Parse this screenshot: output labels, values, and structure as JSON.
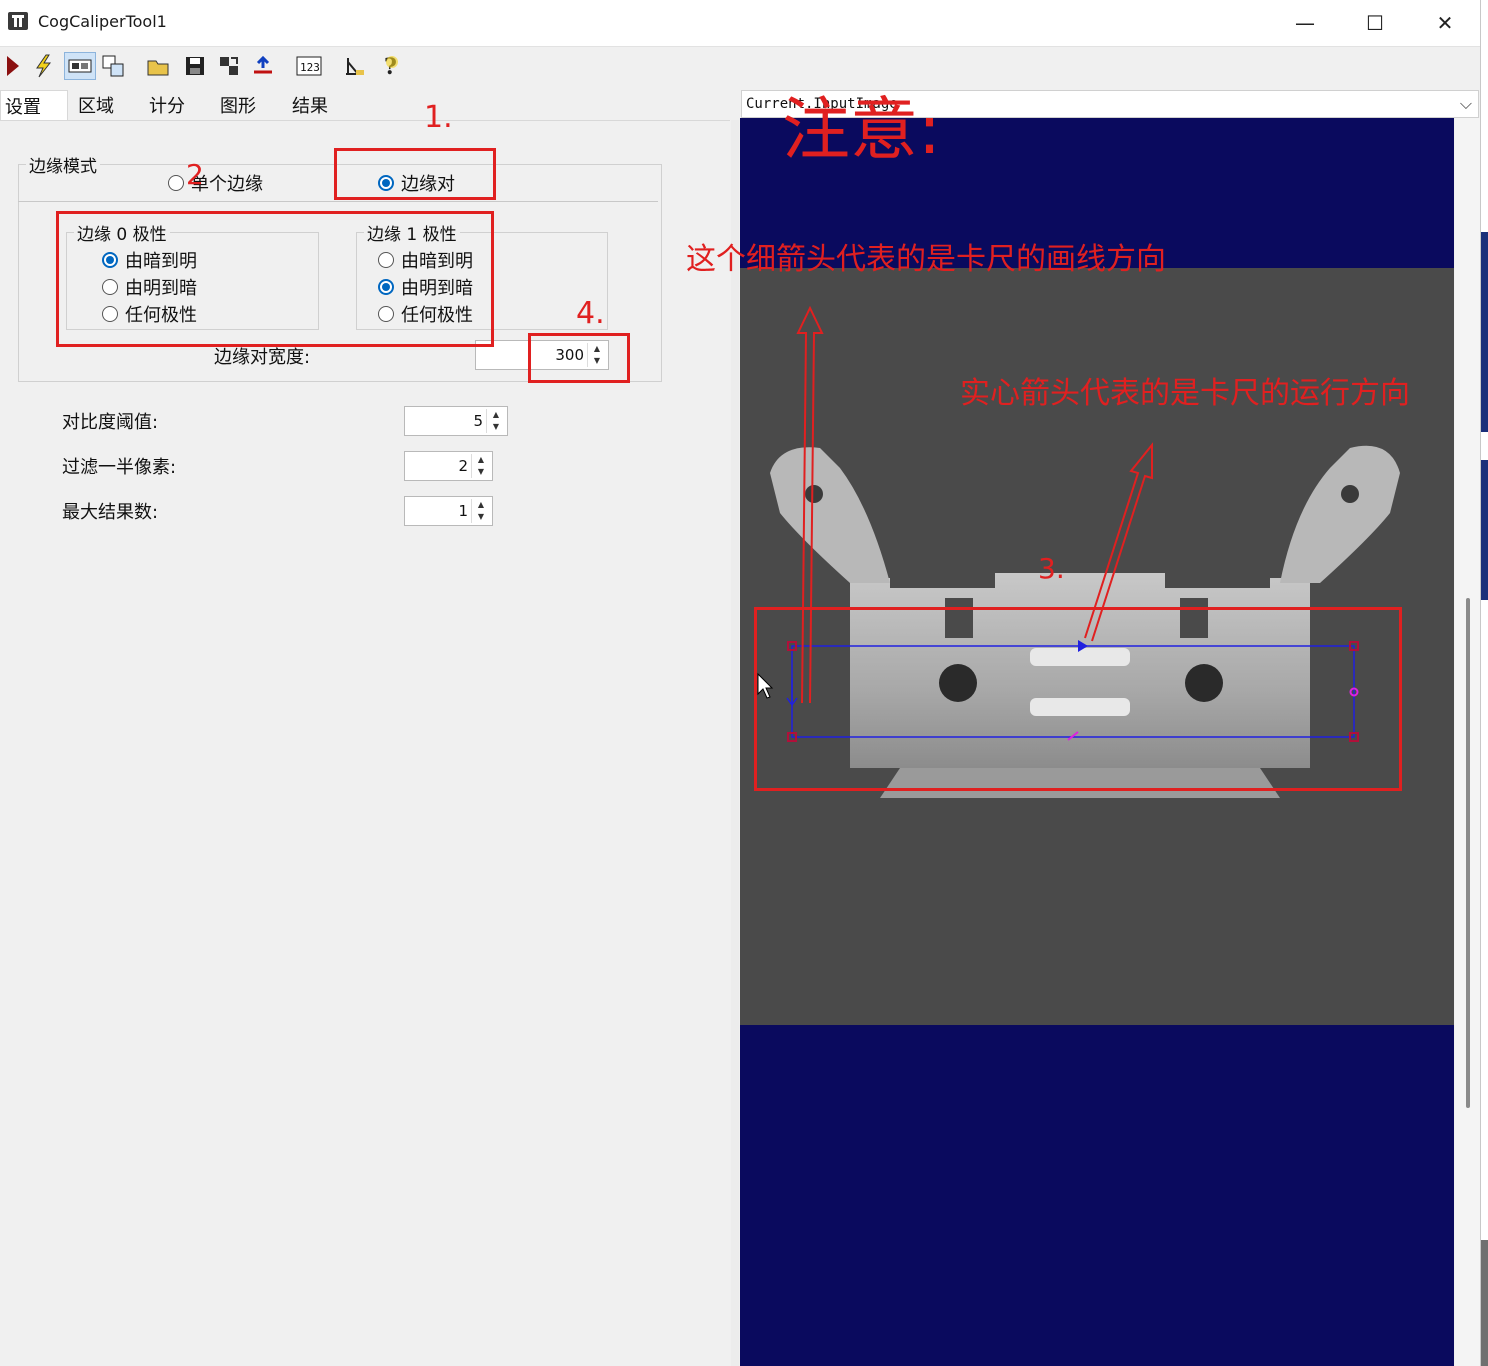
{
  "window": {
    "title": "CogCaliperTool1"
  },
  "window_controls": {
    "minimize": "—",
    "maximize": "☐",
    "close": "✕"
  },
  "toolbar": {
    "icons": [
      "run-icon",
      "electric-icon",
      "display-icon",
      "copy-icon",
      "open-icon",
      "save-icon",
      "import-icon",
      "reset-icon",
      "counter-icon",
      "measure-icon",
      "help-icon"
    ]
  },
  "tabs": [
    "设置",
    "区域",
    "计分",
    "图形",
    "结果"
  ],
  "edge_mode": {
    "legend": "边缘模式",
    "single_label": "单个边缘",
    "pair_label": "边缘对",
    "selected": "边缘对"
  },
  "edge0": {
    "legend": "边缘 0 极性",
    "options": [
      "由暗到明",
      "由明到暗",
      "任何极性"
    ],
    "selected_index": 0
  },
  "edge1": {
    "legend": "边缘 1 极性",
    "options": [
      "由暗到明",
      "由明到暗",
      "任何极性"
    ],
    "selected_index": 1
  },
  "edge_pair_width": {
    "label": "边缘对宽度:",
    "value": "300"
  },
  "params": [
    {
      "label": "对比度阈值:",
      "value": "5"
    },
    {
      "label": "过滤一半像素:",
      "value": "2"
    },
    {
      "label": "最大结果数:",
      "value": "1"
    }
  ],
  "image_selector": {
    "value": "Current.InputImage"
  },
  "annotations": {
    "n1": "1.",
    "n2": "2",
    "n3": "3.",
    "n4": "4.",
    "note_title": "注意:",
    "thin_arrow_note": "这个细箭头代表的是卡尺的画线方向",
    "solid_arrow_note": "实心箭头代表的是卡尺的运行方向"
  },
  "colors": {
    "display_bg": "#0a0a5e",
    "annotation": "#e02020",
    "caliper": "#2020e0",
    "handle": "#b0103a",
    "accent": "#0067c0"
  }
}
